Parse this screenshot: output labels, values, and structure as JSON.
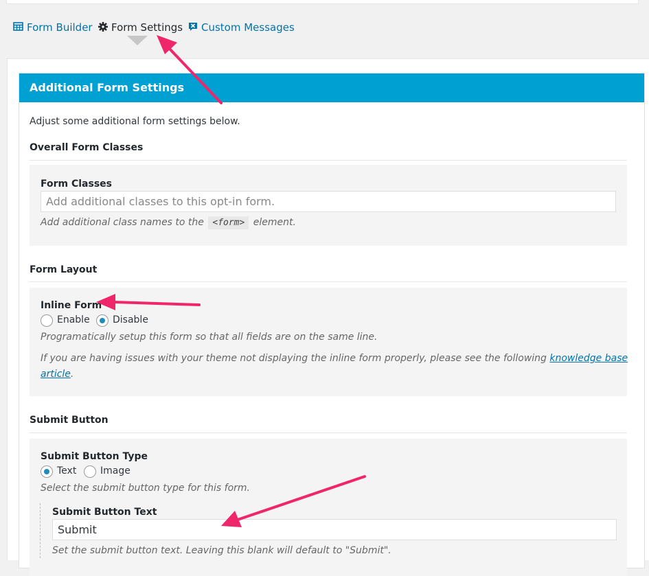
{
  "tabs": [
    {
      "label": "Form Builder",
      "icon": "table-icon"
    },
    {
      "label": "Form Settings",
      "icon": "gear-icon"
    },
    {
      "label": "Custom Messages",
      "icon": "message-x-icon"
    }
  ],
  "section": {
    "title": "Additional Form Settings",
    "intro": "Adjust some additional form settings below."
  },
  "overall_classes": {
    "heading": "Overall Form Classes",
    "field_label": "Form Classes",
    "placeholder": "Add additional classes to this opt-in form.",
    "help_before": "Add additional class names to the",
    "help_code": "<form>",
    "help_after": "element."
  },
  "layout": {
    "heading": "Form Layout",
    "field_label": "Inline Form",
    "options": [
      "Enable",
      "Disable"
    ],
    "selected": "Disable",
    "help": "Programatically setup this form so that all fields are on the same line.",
    "help2_before": "If you are having issues with your theme not displaying the inline form properly, please see the following",
    "help2_link_line1": "knowledge base",
    "help2_link_line2": "article",
    "help2_after": "."
  },
  "submit": {
    "heading": "Submit Button",
    "type_label": "Submit Button Type",
    "type_options": [
      "Text",
      "Image"
    ],
    "type_selected": "Text",
    "type_help": "Select the submit button type for this form.",
    "text_label": "Submit Button Text",
    "text_value": "Submit",
    "text_help": "Set the submit button text. Leaving this blank will default to \"Submit\"."
  },
  "colors": {
    "header_bg": "#00a0d2",
    "link": "#0073aa",
    "annotation_arrow": "#f0266b"
  }
}
